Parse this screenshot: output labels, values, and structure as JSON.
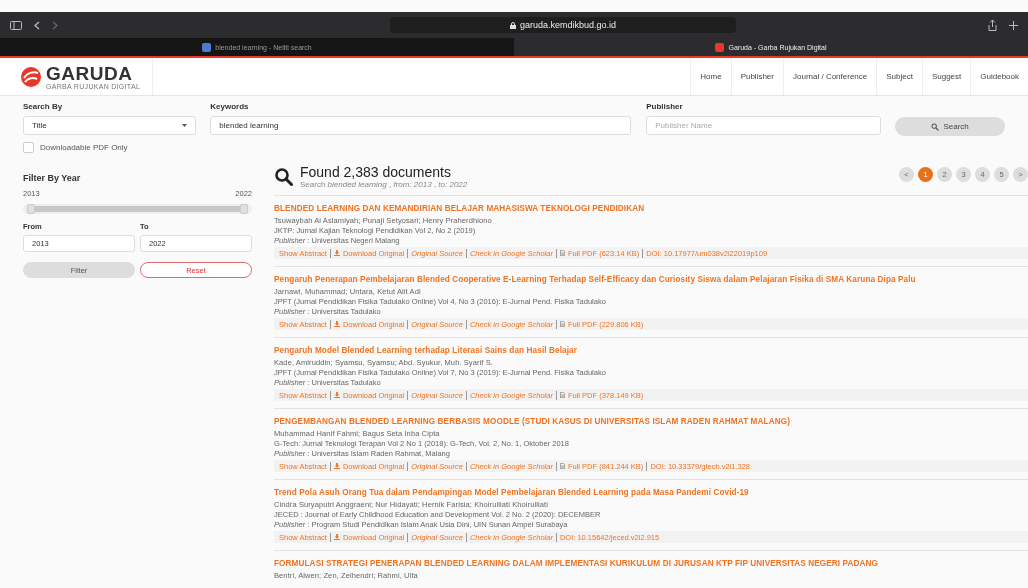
{
  "browser": {
    "address": "garuda.kemdikbud.go.id",
    "tabs": [
      {
        "title": "blended learning - Neliti search",
        "selected": false
      },
      {
        "title": "Garuda - Garba Rujukan Digital",
        "selected": true
      }
    ]
  },
  "header": {
    "logo": "GARUDA",
    "logo_subtitle": "GARBA RUJUKAN DIGITAL",
    "nav": [
      "Home",
      "Publisher",
      "Journal / Conference",
      "Subject",
      "Suggest",
      "Guidebook"
    ]
  },
  "search": {
    "search_by_label": "Search By",
    "search_by_value": "Title",
    "keywords_label": "Keywords",
    "keywords_value": "blended learning",
    "publisher_label": "Publisher",
    "publisher_placeholder": "Publisher Name",
    "button": "Search",
    "pdf_only": {
      "label": "Downloadable PDF Only",
      "checked": false
    }
  },
  "filter": {
    "title": "Filter By Year",
    "min": "2013",
    "max": "2022",
    "from_label": "From",
    "from_value": "2013",
    "to_label": "To",
    "to_value": "2022",
    "filter_button": "Filter",
    "reset_button": "Reset",
    "slider": {
      "level": 1
    }
  },
  "results_header": {
    "title": "Found 2,383 documents",
    "subtitle": "Search *blended learning* , *from: 2013* , *to: 2022*"
  },
  "pagination": [
    {
      "label": "<",
      "selected": false
    },
    {
      "label": "1",
      "selected": true
    },
    {
      "label": "2",
      "selected": false
    },
    {
      "label": "3",
      "selected": false
    },
    {
      "label": "4",
      "selected": false
    },
    {
      "label": "5",
      "selected": false
    },
    {
      "label": ">",
      "selected": false
    }
  ],
  "results": [
    {
      "title": "BLENDED LEARNING DAN KEMANDIRIAN BELAJAR MAHASISWA TEKNOLOGI PENDIDIKAN",
      "authors": "Tsuwaybah Al Aslamiyah; Punaji Setyosari; Henry Praherdhiono",
      "journal": "JKTP: Jurnal Kajian Teknologi Pendidikan Vol 2, No 2 (2019)",
      "publisher": "*Publisher* : Universitas Negeri Malang",
      "links": [
        {
          "kind": "abstract",
          "text": "Show Abstract"
        },
        {
          "kind": "download",
          "text": "Download Original"
        },
        {
          "kind": "source",
          "text": "Original Source"
        },
        {
          "kind": "scholar",
          "text": "Check in Google Scholar"
        },
        {
          "kind": "pdf",
          "text": "Full PDF (623.14 KB)"
        },
        {
          "kind": "doi",
          "text": "DOI: 10.17977/um038v2i22019p109"
        }
      ]
    },
    {
      "title": "Pengaruh Penerapan Pembelajaran Blended Cooperative E-Learning Terhadap Self-Efficacy dan Curiosity Siswa dalam Pelajaran Fisika di SMA Karuna Dipa Palu",
      "authors": "Jarnawi, Muhammad; Untara, Ketut Alit Adi",
      "journal": "JPFT (Jurnal Pendidikan Fisika Tadulako Online) Vol 4, No 3 (2016): E-Jurnal Pend. Fisika Tadulako",
      "publisher": "*Publisher* : Universitas Tadulako",
      "links": [
        {
          "kind": "abstract",
          "text": "Show Abstract"
        },
        {
          "kind": "download",
          "text": "Download Original"
        },
        {
          "kind": "source",
          "text": "Original Source"
        },
        {
          "kind": "scholar",
          "text": "Check in Google Scholar"
        },
        {
          "kind": "pdf",
          "text": "Full PDF (229.806 KB)"
        }
      ]
    },
    {
      "title": "Pengaruh Model Blended Learning terhadap Literasi Sains dan Hasil Belajar",
      "authors": "Kade, Amiruddin; Syamsu, Syamsu; Abd. Syukur, Muh. Syarif S.",
      "journal": "JPFT (Jurnal Pendidikan Fisika Tadulako Online) Vol 7, No 3 (2019): E-Jurnal Pend. Fisika Tadulako",
      "publisher": "*Publisher* : Universitas Tadulako",
      "links": [
        {
          "kind": "abstract",
          "text": "Show Abstract"
        },
        {
          "kind": "download",
          "text": "Download Original"
        },
        {
          "kind": "source",
          "text": "Original Source"
        },
        {
          "kind": "scholar",
          "text": "Check in Google Scholar"
        },
        {
          "kind": "pdf",
          "text": "Full PDF (378.149 KB)"
        }
      ]
    },
    {
      "title": "PENGEMBANGAN BLENDED LEARNING BERBASIS MOODLE (STUDI KASUS DI UNIVERSITAS ISLAM RADEN RAHMAT MALANG)",
      "authors": "Muhammad Hanif Fahmi; Bagus Seta Inba Cipta",
      "journal": "G-Tech: Jurnal Teknologi Terapan Vol 2 No 1 (2018): G-Tech, Vol. 2, No. 1, Oktober 2018",
      "publisher": "*Publisher* : Universitas Islam Raden Rahmat, Malang",
      "links": [
        {
          "kind": "abstract",
          "text": "Show Abstract"
        },
        {
          "kind": "download",
          "text": "Download Original"
        },
        {
          "kind": "source",
          "text": "Original Source"
        },
        {
          "kind": "scholar",
          "text": "Check in Google Scholar"
        },
        {
          "kind": "pdf",
          "text": "Full PDF (841.244 KB)"
        },
        {
          "kind": "doi",
          "text": "DOI: 10.33379/gtech.v2i1.328"
        }
      ]
    },
    {
      "title": "Trend Pola Asuh Orang Tua dalam Pendampingan Model Pembelajaran Blended Learning pada Masa Pandemi Covid-19",
      "authors": "Cindra Suryaputri Anggraeni; Nur Hidayati; Hernik Farisia; Khoirulliati Khoirulliati",
      "journal": "JECED : Journal of Early Childhood Education and Development Vol. 2 No. 2 (2020): DECEMBER",
      "publisher": "*Publisher* : Program Studi Pendidikan Islam Anak Usia Dini, UIN Sunan Ampel Surabaya",
      "links": [
        {
          "kind": "abstract",
          "text": "Show Abstract"
        },
        {
          "kind": "download",
          "text": "Download Original"
        },
        {
          "kind": "source",
          "text": "Original Source"
        },
        {
          "kind": "scholar",
          "text": "Check in Google Scholar"
        },
        {
          "kind": "doi",
          "text": "DOI: 10.15642/jeced.v2i2.915"
        }
      ]
    },
    {
      "title": "FORMULASI STRATEGI PENERAPAN BLENDED LEARNING DALAM IMPLEMENTASI KURIKULUM DI JURUSAN KTP FIP UNIVERSITAS NEGERI PADANG",
      "authors": "Bentri, Alwen; Zen, Zelhendri; Rahmi, Ulfa"
    }
  ]
}
